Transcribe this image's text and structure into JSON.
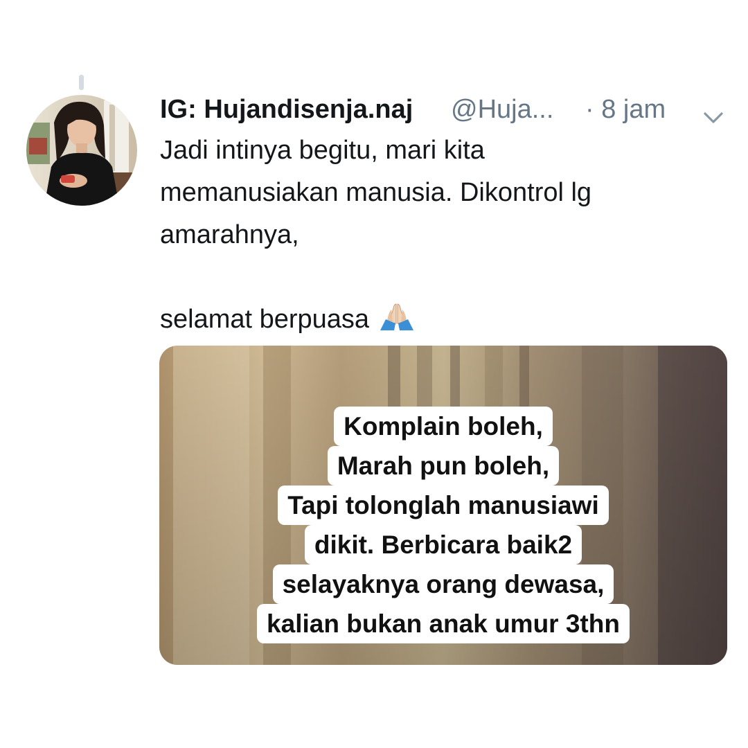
{
  "tweet": {
    "display_name": "IG: Hujandisenja.naj",
    "handle": "@Huja...",
    "time": "· 8 jam",
    "text_lines": [
      "Jadi intinya begitu, mari kita",
      "memanusiakan manusia. Dikontrol lg",
      "amarahnya,"
    ],
    "closing_line": "selamat berpuasa",
    "emoji": "folded-hands"
  },
  "icons": {
    "menu": "chevron-down-icon",
    "emoji": "folded-hands-icon"
  },
  "media": {
    "caption_lines": [
      "Komplain boleh,",
      "Marah pun boleh,",
      "Tapi tolonglah manusiawi",
      "dikit. Berbicara baik2",
      "selayaknya orang dewasa,",
      "kalian bukan anak umur 3thn"
    ]
  },
  "colors": {
    "text_primary": "#14171a",
    "text_secondary": "#657786",
    "background": "#ffffff"
  }
}
